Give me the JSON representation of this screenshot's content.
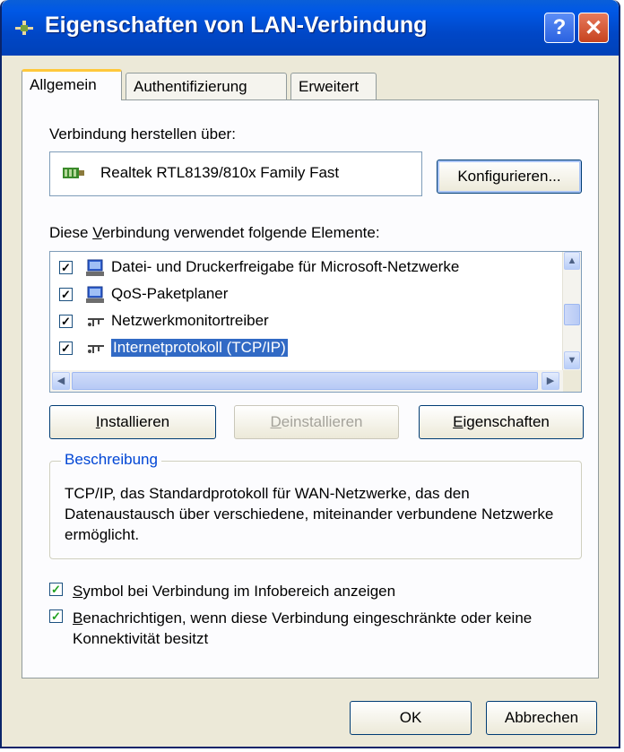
{
  "window": {
    "title": "Eigenschaften von LAN-Verbindung",
    "help_label": "?",
    "close_label": "✕"
  },
  "tabs": [
    {
      "label": "Allgemein",
      "active": true
    },
    {
      "label": "Authentifizierung",
      "active": false
    },
    {
      "label": "Erweitert",
      "active": false
    }
  ],
  "general": {
    "connect_via_label": "Verbindung herstellen über:",
    "adapter_name": "Realtek RTL8139/810x Family Fast",
    "configure_button": "Konfigurieren...",
    "components_label": {
      "pre": "Diese ",
      "hotkey": "V",
      "post": "erbindung verwendet folgende Elemente:"
    },
    "components": [
      {
        "label": "Datei- und Druckerfreigabe für Microsoft-Netzwerke",
        "checked": true,
        "icon": "network-service-icon"
      },
      {
        "label": "QoS-Paketplaner",
        "checked": true,
        "icon": "network-service-icon"
      },
      {
        "label": "Netzwerkmonitortreiber",
        "checked": true,
        "icon": "protocol-icon"
      },
      {
        "label": "Internetprotokoll (TCP/IP)",
        "checked": true,
        "icon": "protocol-icon",
        "selected": true
      }
    ],
    "install_button": {
      "hotkey": "I",
      "rest": "nstallieren"
    },
    "uninstall_button": {
      "hotkey": "D",
      "rest": "einstallieren",
      "enabled": false
    },
    "properties_button": {
      "hotkey": "E",
      "rest": "igenschaften"
    },
    "description": {
      "title": "Beschreibung",
      "text": "TCP/IP, das Standardprotokoll für WAN-Netzwerke, das den Datenaustausch über verschiedene, miteinander verbundene Netzwerke ermöglicht."
    },
    "show_icon_option": {
      "hotkey": "S",
      "rest": "ymbol bei Verbindung im Infobereich anzeigen",
      "checked": true
    },
    "notify_option": {
      "hotkey": "B",
      "rest": "enachrichtigen, wenn diese Verbindung eingeschränkte oder keine Konnektivität besitzt",
      "checked": true
    }
  },
  "footer": {
    "ok_label": "OK",
    "cancel_label": "Abbrechen"
  },
  "colors": {
    "titlebar": "#0050d8",
    "selection": "#316ac5",
    "group_title": "#0046d5",
    "checkmark": "#21a121"
  }
}
